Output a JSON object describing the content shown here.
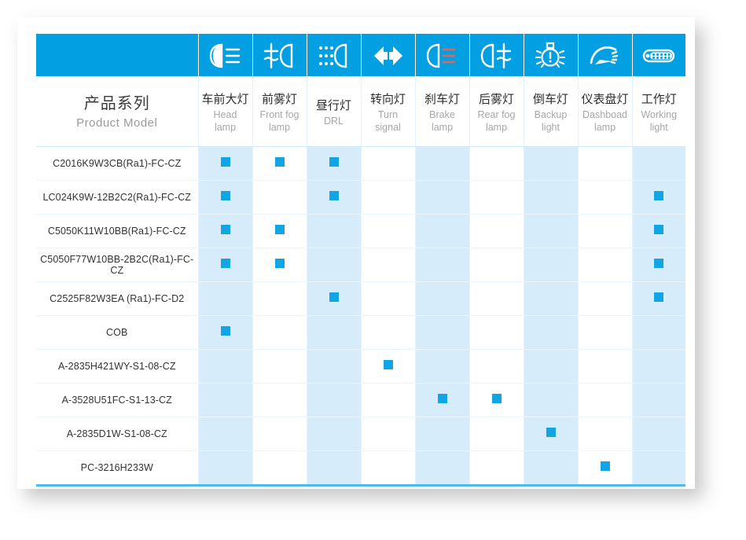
{
  "table": {
    "model_column": {
      "cn": "产品系列",
      "en": "Product Model"
    },
    "columns": [
      {
        "cn": "车前大灯",
        "en": "Head lamp",
        "icon": "low-beam-headlamp-icon"
      },
      {
        "cn": "前雾灯",
        "en": "Front fog lamp",
        "icon": "front-fog-lamp-icon"
      },
      {
        "cn": "昼行灯",
        "en": "DRL",
        "icon": "daytime-running-lamp-icon"
      },
      {
        "cn": "转向灯",
        "en": "Turn signal",
        "icon": "turn-signal-arrows-icon"
      },
      {
        "cn": "刹车灯",
        "en": "Brake lamp",
        "icon": "brake-lamp-icon"
      },
      {
        "cn": "后雾灯",
        "en": "Rear fog lamp",
        "icon": "rear-fog-lamp-icon"
      },
      {
        "cn": "倒车灯",
        "en": "Backup light",
        "icon": "backup-light-bulb-icon"
      },
      {
        "cn": "仪表盘灯",
        "en": "Dashboad lamp",
        "icon": "dashboard-gauge-icon"
      },
      {
        "cn": "工作灯",
        "en": "Working light",
        "icon": "work-light-bar-icon"
      }
    ],
    "rows": [
      {
        "model": "C2016K9W3CB(Ra1)-FC-CZ",
        "marks": [
          1,
          1,
          1,
          0,
          0,
          0,
          0,
          0,
          0
        ]
      },
      {
        "model": "LC024K9W-12B2C2(Ra1)-FC-CZ",
        "marks": [
          1,
          0,
          1,
          0,
          0,
          0,
          0,
          0,
          1
        ]
      },
      {
        "model": "C5050K11W10BB(Ra1)-FC-CZ",
        "marks": [
          1,
          1,
          0,
          0,
          0,
          0,
          0,
          0,
          1
        ]
      },
      {
        "model": "C5050F77W10BB-2B2C(Ra1)-FC-CZ",
        "marks": [
          1,
          1,
          0,
          0,
          0,
          0,
          0,
          0,
          1
        ]
      },
      {
        "model": "C2525F82W3EA (Ra1)-FC-D2",
        "marks": [
          0,
          0,
          1,
          0,
          0,
          0,
          0,
          0,
          1
        ]
      },
      {
        "model": "COB",
        "marks": [
          1,
          0,
          0,
          0,
          0,
          0,
          0,
          0,
          0
        ]
      },
      {
        "model": "A-2835H421WY-S1-08-CZ",
        "marks": [
          0,
          0,
          0,
          1,
          0,
          0,
          0,
          0,
          0
        ]
      },
      {
        "model": "A-3528U51FC-S1-13-CZ",
        "marks": [
          0,
          0,
          0,
          0,
          1,
          1,
          0,
          0,
          0
        ]
      },
      {
        "model": "A-2835D1W-S1-08-CZ",
        "marks": [
          0,
          0,
          0,
          0,
          0,
          0,
          1,
          0,
          0
        ]
      },
      {
        "model": "PC-3216H233W",
        "marks": [
          0,
          0,
          0,
          0,
          0,
          0,
          0,
          1,
          0
        ]
      }
    ]
  },
  "colors": {
    "header_blue": "#02a0e2",
    "marker_blue": "#11a5e4",
    "column_tint": "#d6ecfa",
    "bottom_rule": "#4fb9e8",
    "grid_line": "#e3f2fc"
  }
}
